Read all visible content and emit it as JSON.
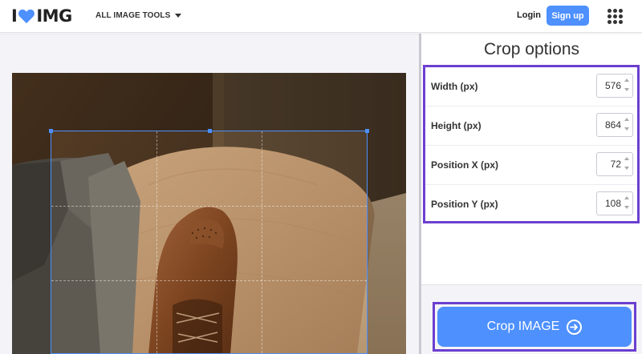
{
  "header": {
    "logo_left": "I",
    "logo_right": "IMG",
    "tools_label": "ALL IMAGE TOOLS",
    "login_label": "Login",
    "signup_label": "Sign up"
  },
  "sidebar": {
    "title": "Crop options",
    "options": [
      {
        "label": "Width (px)",
        "value": "576"
      },
      {
        "label": "Height (px)",
        "value": "864"
      },
      {
        "label": "Position X (px)",
        "value": "72"
      },
      {
        "label": "Position Y (px)",
        "value": "108"
      }
    ],
    "crop_button_label": "Crop IMAGE"
  },
  "colors": {
    "brand_blue": "#4d90fe",
    "highlight_purple": "#6b3fd0"
  },
  "icons": {
    "logo": "heart-icon",
    "menu": "apps-grid-icon",
    "dropdown": "caret-down-icon",
    "button": "arrow-circle-right-icon"
  }
}
